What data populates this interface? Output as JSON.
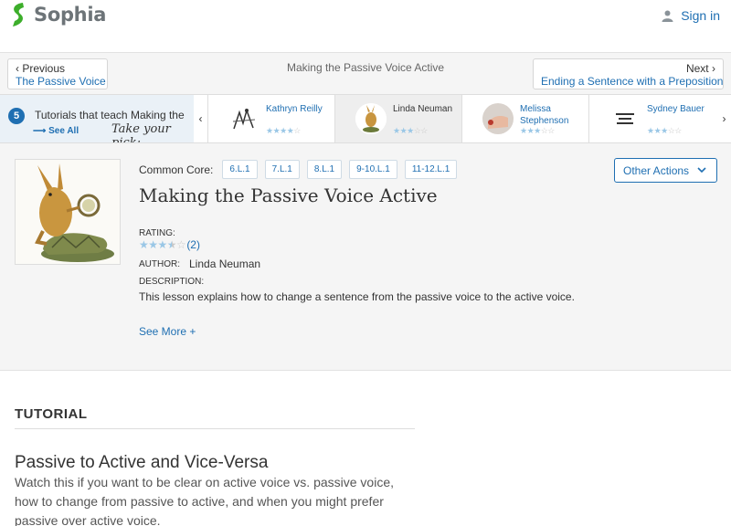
{
  "header": {
    "brand": "Sophia",
    "signin_label": "Sign in",
    "brand_color": "#3dae2b",
    "link_color": "#1f6fb2"
  },
  "nav": {
    "prev_label": "Previous",
    "prev_target": "The Passive Voice",
    "current_title": "Making the Passive Voice Active",
    "next_label": "Next",
    "next_target": "Ending a Sentence with a Preposition"
  },
  "carousel": {
    "count": "5",
    "label": "Tutorials that teach Making the",
    "see_all": "See All",
    "pick_text": "Take your pick:",
    "cards": [
      {
        "name": "Kathryn Reilly",
        "rating": 4,
        "max": 5
      },
      {
        "name": "Linda Neuman",
        "rating": 3,
        "max": 5,
        "active": true
      },
      {
        "name": "Melissa Stephenson",
        "rating": 3,
        "max": 5
      },
      {
        "name": "Sydney Bauer",
        "rating": 3,
        "max": 5
      }
    ]
  },
  "overview": {
    "common_core_label": "Common Core:",
    "standards": [
      "6.L.1",
      "7.L.1",
      "8.L.1",
      "9-10.L.1",
      "11-12.L.1"
    ],
    "other_actions_label": "Other Actions",
    "title": "Making the Passive Voice Active",
    "rating_label": "RATING:",
    "rating_value": 3.5,
    "rating_max": 5,
    "rating_count": "(2)",
    "author_label": "AUTHOR:",
    "author": "Linda Neuman",
    "description_label": "DESCRIPTION:",
    "description": "This lesson explains how to change a sentence from the passive voice to the active voice.",
    "see_more": "See More +"
  },
  "tutorial": {
    "heading": "TUTORIAL",
    "title": "Passive to Active and Vice-Versa",
    "description": "Watch this if you want to be clear on active voice vs. passive voice, how to change from passive to active, and when you might prefer passive over active voice."
  }
}
